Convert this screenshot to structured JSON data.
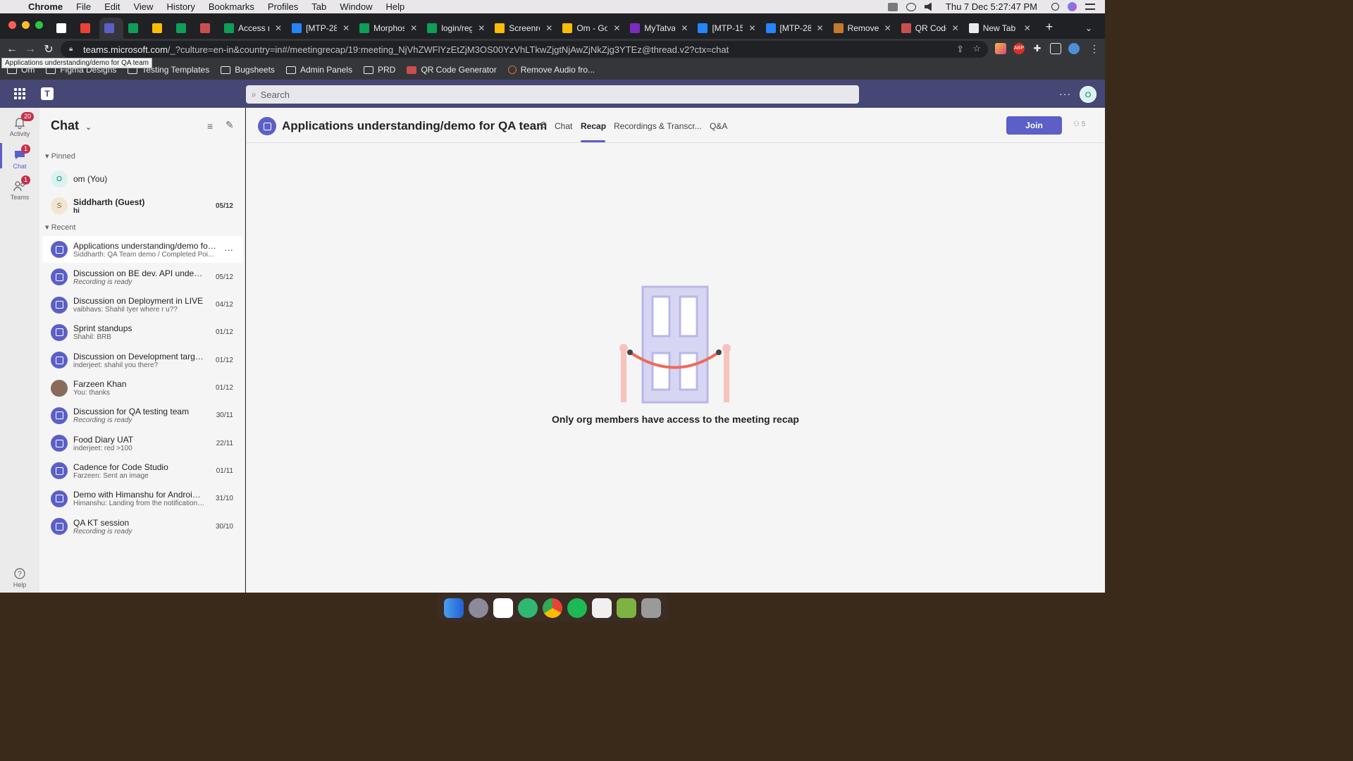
{
  "menubar": {
    "app": "Chrome",
    "items": [
      "File",
      "Edit",
      "View",
      "History",
      "Bookmarks",
      "Profiles",
      "Tab",
      "Window",
      "Help"
    ],
    "clock": "Thu 7 Dec  5:27:47 PM"
  },
  "tabs": [
    {
      "title": "",
      "color": "#ffffff"
    },
    {
      "title": "",
      "color": "#ea4335"
    },
    {
      "title": "",
      "color": "#5b5fc7"
    },
    {
      "title": "",
      "color": "#0f9d58"
    },
    {
      "title": "",
      "color": "#fbbc04"
    },
    {
      "title": "",
      "color": "#0f9d58"
    },
    {
      "title": "",
      "color": "#c94f4f"
    },
    {
      "title": "Access r",
      "color": "#0f9d58"
    },
    {
      "title": "[MTP-28",
      "color": "#2684ff"
    },
    {
      "title": "Morphos",
      "color": "#0f9d58"
    },
    {
      "title": "login/reg",
      "color": "#0f9d58"
    },
    {
      "title": "Screenre",
      "color": "#fbbc04"
    },
    {
      "title": "Om - Go",
      "color": "#fbbc04"
    },
    {
      "title": "MyTatva",
      "color": "#7b2cbf"
    },
    {
      "title": "[MTP-15",
      "color": "#2684ff"
    },
    {
      "title": "[MTP-28",
      "color": "#2684ff"
    },
    {
      "title": "Remove",
      "color": "#c27a2c"
    },
    {
      "title": "QR Code",
      "color": "#c94f4f"
    },
    {
      "title": "New Tab",
      "color": "#e8eaed"
    }
  ],
  "url": {
    "host": "teams.microsoft.com",
    "path": "/_?culture=en-in&country=in#/meetingrecap/19:meeting_NjVhZWFlYzEtZjM3OS00YzVhLTkwZjgtNjAwZjNkZjg3YTEz@thread.v2?ctx=chat"
  },
  "bookmarks": [
    "Om",
    "Figma Designs",
    "Testing Templates",
    "Bugsheets",
    "Admin Panels",
    "PRD",
    "QR Code Generator",
    "Remove Audio fro..."
  ],
  "tooltip": "Applications understanding/demo for QA team",
  "teams": {
    "search_placeholder": "Search",
    "avatar_initial": "O"
  },
  "rail": {
    "activity": {
      "label": "Activity",
      "badge": "20"
    },
    "chat": {
      "label": "Chat",
      "badge": "1"
    },
    "teams": {
      "label": "Teams",
      "badge": "1"
    },
    "help": {
      "label": "Help"
    }
  },
  "sidebar": {
    "title": "Chat",
    "pinned_label": "Pinned",
    "recent_label": "Recent",
    "pinned": [
      {
        "name": "om (You)",
        "sub": "",
        "date": "",
        "initial": "O"
      },
      {
        "name": "Siddharth (Guest)",
        "sub": "hi",
        "date": "05/12",
        "initial": "S"
      }
    ],
    "recent": [
      {
        "name": "Applications understanding/demo for ...",
        "sub": "Siddharth: QA Team demo / Completed Poi...",
        "date": "",
        "italic": false,
        "selected": true
      },
      {
        "name": "Discussion on BE dev. API understa...",
        "sub": "Recording is ready",
        "date": "05/12",
        "italic": true
      },
      {
        "name": "Discussion on Deployment in LIVE",
        "sub": "vaibhavs: Shahil Iyer where r u??",
        "date": "04/12",
        "italic": false
      },
      {
        "name": "Sprint standups",
        "sub": "Shahil: BRB",
        "date": "01/12",
        "italic": false
      },
      {
        "name": "Discussion on Development target (...",
        "sub": "inderjeet: shahil you there?",
        "date": "01/12",
        "italic": false
      },
      {
        "name": "Farzeen Khan",
        "sub": "You: thanks",
        "date": "01/12",
        "italic": false,
        "person": true
      },
      {
        "name": "Discussion for QA testing team",
        "sub": "Recording is ready",
        "date": "30/11",
        "italic": true
      },
      {
        "name": "Food Diary UAT",
        "sub": "inderjeet: red >100",
        "date": "22/11",
        "italic": false
      },
      {
        "name": "Cadence for Code Studio",
        "sub": "Farzeen: Sent an image",
        "date": "01/11",
        "italic": false
      },
      {
        "name": "Demo with Himanshu for Android App",
        "sub": "Himanshu: Landing from the notification bell ...",
        "date": "31/10",
        "italic": false
      },
      {
        "name": "QA KT session",
        "sub": "Recording is ready",
        "date": "30/10",
        "italic": true
      }
    ]
  },
  "main": {
    "title": "Applications understanding/demo for QA team",
    "tabs": [
      "Chat",
      "Recap",
      "Recordings & Transcr...",
      "Q&A"
    ],
    "join_label": "Join",
    "participants": "5",
    "message": "Only org members have access to the meeting recap"
  },
  "colors": {
    "accent": "#5b5fc7",
    "teams_bar": "#464775",
    "badge": "#c4314b"
  }
}
